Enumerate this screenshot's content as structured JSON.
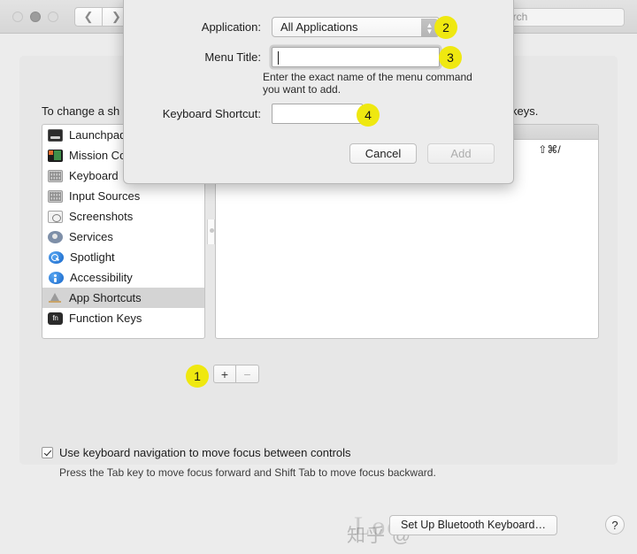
{
  "window": {
    "traffic_lights": [
      "close",
      "minimize",
      "zoom"
    ],
    "nav_back_icon": "chevron-left-icon",
    "nav_forward_icon": "chevron-right-icon",
    "search_value": "arch",
    "search_full": "Search"
  },
  "main": {
    "intro_text_left": "To change a sh",
    "intro_text_right": "keys.",
    "sidebar": {
      "items": [
        {
          "label": "Launchpad",
          "icon": "launchpad-icon",
          "selected": false
        },
        {
          "label": "Mission Control",
          "icon": "mission-control-icon",
          "selected": false
        },
        {
          "label": "Keyboard",
          "icon": "keyboard-icon",
          "selected": false
        },
        {
          "label": "Input Sources",
          "icon": "input-sources-icon",
          "selected": false
        },
        {
          "label": "Screenshots",
          "icon": "screenshots-icon",
          "selected": false
        },
        {
          "label": "Services",
          "icon": "services-icon",
          "selected": false
        },
        {
          "label": "Spotlight",
          "icon": "spotlight-icon",
          "selected": false
        },
        {
          "label": "Accessibility",
          "icon": "accessibility-icon",
          "selected": false
        },
        {
          "label": "App Shortcuts",
          "icon": "app-shortcuts-icon",
          "selected": true
        },
        {
          "label": "Function Keys",
          "icon": "function-keys-icon",
          "selected": false
        }
      ]
    },
    "table": {
      "rows": [
        {
          "name": "",
          "shortcut": "⇧⌘/"
        }
      ]
    },
    "add_button_label": "+",
    "remove_button_label": "−",
    "checkbox": {
      "checked": true,
      "label": "Use keyboard navigation to move focus between controls",
      "hint": "Press the Tab key to move focus forward and Shift Tab to move focus backward."
    }
  },
  "footer": {
    "bluetooth_button_label": "Set Up Bluetooth Keyboard…",
    "help_label": "?",
    "watermark": "Looc○r",
    "watermark_cjk": "知乎 @"
  },
  "sheet": {
    "application_label": "Application:",
    "application_value": "All Applications",
    "menu_title_label": "Menu Title:",
    "menu_title_value": "",
    "menu_title_hint": "Enter the exact name of the menu command you want to add.",
    "keyboard_shortcut_label": "Keyboard Shortcut:",
    "keyboard_shortcut_value": "",
    "cancel_label": "Cancel",
    "add_label": "Add"
  },
  "badges": {
    "one": "1",
    "two": "2",
    "three": "3",
    "four": "4"
  },
  "colors": {
    "badge_yellow": "#efe810",
    "window_bg": "#ececec",
    "selected_row": "#d4d4d4"
  }
}
